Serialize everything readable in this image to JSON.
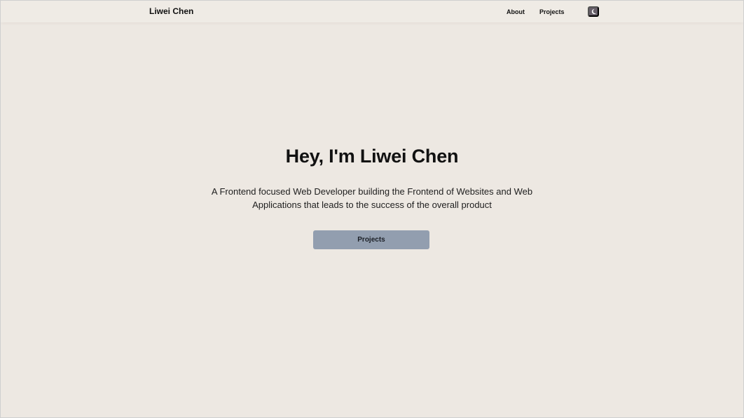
{
  "header": {
    "brand": "Liwei Chen",
    "nav": [
      {
        "label": "About"
      },
      {
        "label": "Projects"
      }
    ],
    "theme_toggle_icon": "moon-icon"
  },
  "hero": {
    "title": "Hey, I'm Liwei Chen",
    "subtitle": "A Frontend focused Web Developer building the Frontend of Websites and Web Applications that leads to the success of the overall product",
    "button_label": "Projects"
  },
  "colors": {
    "background": "#ede8e2",
    "button": "#929eaf",
    "toggle": "#675f69"
  }
}
